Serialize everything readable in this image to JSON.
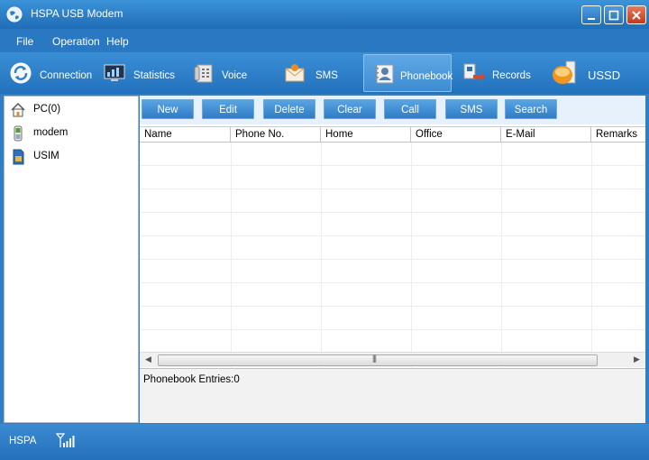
{
  "window": {
    "title": "HSPA USB Modem"
  },
  "menu": {
    "items": [
      "File",
      "Operation",
      "Help"
    ]
  },
  "toolbar": {
    "items": [
      {
        "label": "Connection",
        "icon": "connection-icon"
      },
      {
        "label": "Statistics",
        "icon": "statistics-icon"
      },
      {
        "label": "Voice",
        "icon": "voice-icon"
      },
      {
        "label": "SMS",
        "icon": "sms-icon"
      },
      {
        "label": "Phonebook",
        "icon": "phonebook-icon",
        "active": true
      },
      {
        "label": "Records",
        "icon": "records-icon"
      },
      {
        "label": "USSD",
        "icon": "ussd-icon"
      }
    ]
  },
  "tree": {
    "items": [
      {
        "label": "PC(0)",
        "icon": "pc-home-icon"
      },
      {
        "label": "modem",
        "icon": "modem-icon"
      },
      {
        "label": "USIM",
        "icon": "usim-icon"
      }
    ]
  },
  "actions": {
    "buttons": [
      "New",
      "Edit",
      "Delete",
      "Clear",
      "Call",
      "SMS",
      "Search"
    ]
  },
  "table": {
    "columns": [
      "Name",
      "Phone No.",
      "Home",
      "Office",
      "E-Mail",
      "Remarks"
    ],
    "rows": []
  },
  "status": {
    "entries_label": "Phonebook Entries:0"
  },
  "statusbar": {
    "network": "HSPA"
  },
  "colors": {
    "accent": "#2f7fc4",
    "toolbar_active": "#5fa8e6",
    "close_button": "#c13a1c"
  }
}
